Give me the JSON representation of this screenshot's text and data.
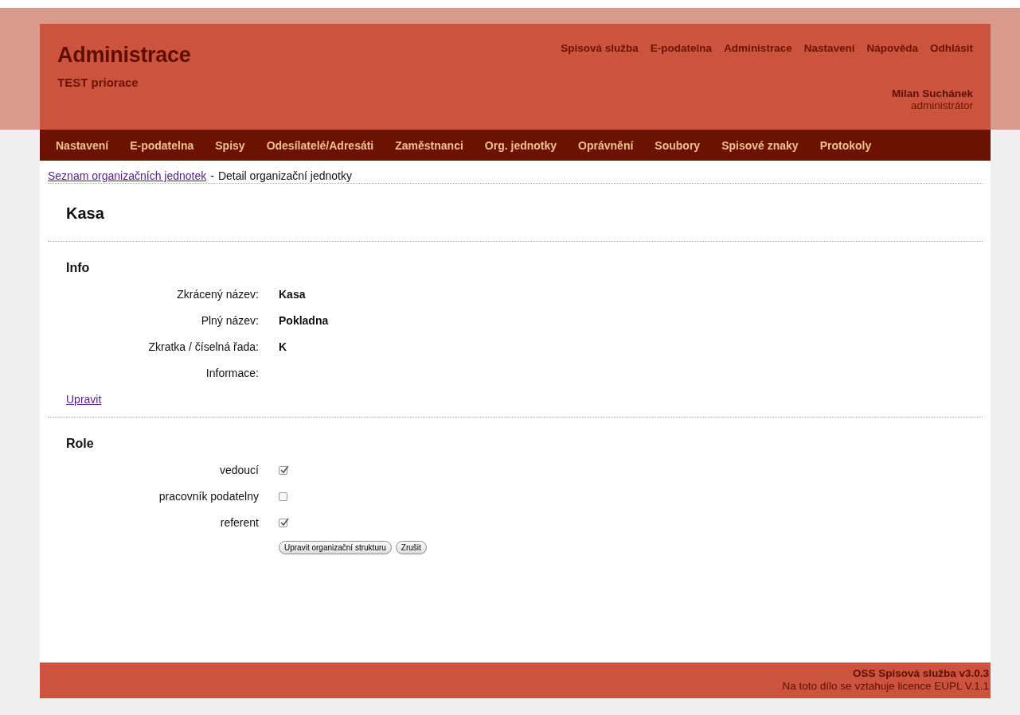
{
  "header": {
    "title": "Administrace",
    "subtitle": "TEST priorace",
    "top_links": [
      "Spisová služba",
      "E-podatelna",
      "Administrace",
      "Nastavení",
      "Nápověda",
      "Odhlásit"
    ],
    "user": {
      "name": "Milan Suchánek",
      "role": "administrátor"
    }
  },
  "nav": [
    "Nastavení",
    "E-podatelna",
    "Spisy",
    "Odesílatelé/Adresáti",
    "Zaměstnanci",
    "Org. jednotky",
    "Oprávnění",
    "Soubory",
    "Spisové znaky",
    "Protokoly"
  ],
  "breadcrumb": {
    "link": "Seznam organizačních jednotek",
    "separator": "-",
    "current": "Detail organizační jednotky"
  },
  "heading": "Kasa",
  "info": {
    "title": "Info",
    "fields": [
      {
        "label": "Zkrácený název:",
        "value": "Kasa"
      },
      {
        "label": "Plný název:",
        "value": "Pokladna"
      },
      {
        "label": "Zkratka / číselná řada:",
        "value": "K"
      },
      {
        "label": "Informace:"
      }
    ],
    "edit_link": "Upravit"
  },
  "roles": {
    "title": "Role",
    "items": [
      {
        "label": "vedoucí",
        "checked": true
      },
      {
        "label": "pracovník podatelny",
        "checked": false
      },
      {
        "label": "referent",
        "checked": true
      }
    ],
    "buttons": [
      "Upravit organizační strukturu",
      "Zrušit"
    ]
  },
  "footer": {
    "line1": "OSS Spisová služba v3.0.3",
    "line2": "Na toto dílo se vztahuje licence EUPL V.1.1"
  }
}
